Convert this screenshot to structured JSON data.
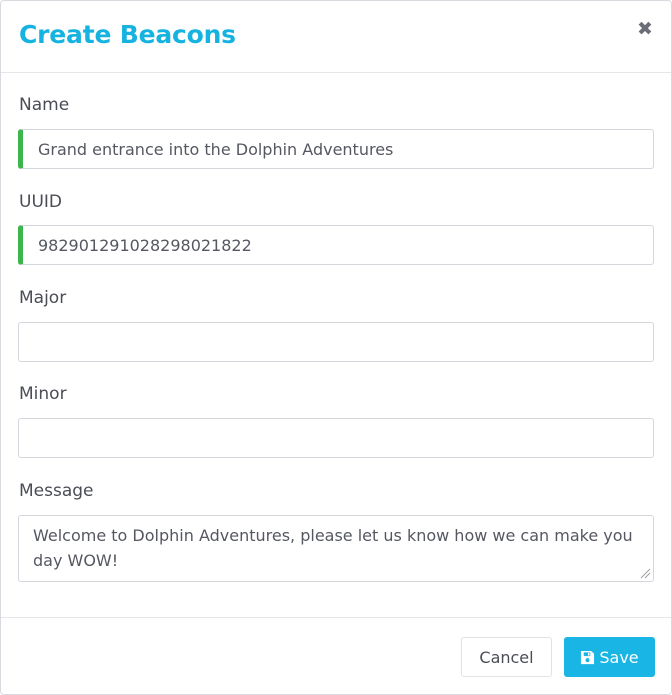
{
  "dialog": {
    "title": "Create Beacons",
    "close_icon": "close-icon"
  },
  "form": {
    "name": {
      "label": "Name",
      "value": "Grand entrance into the Dolphin Adventures",
      "placeholder": ""
    },
    "uuid": {
      "label": "UUID",
      "value": "982901291028298021822",
      "placeholder": ""
    },
    "major": {
      "label": "Major",
      "value": "",
      "placeholder": ""
    },
    "minor": {
      "label": "Minor",
      "value": "",
      "placeholder": ""
    },
    "message": {
      "label": "Message",
      "value": "Welcome to Dolphin Adventures, please let us know how we can make you day WOW!"
    }
  },
  "footer": {
    "cancel_label": "Cancel",
    "save_label": "Save",
    "save_icon": "floppy-disk-icon"
  },
  "colors": {
    "accent": "#16b3e0",
    "valid": "#3cb54a",
    "save_button": "#19b5e4"
  }
}
